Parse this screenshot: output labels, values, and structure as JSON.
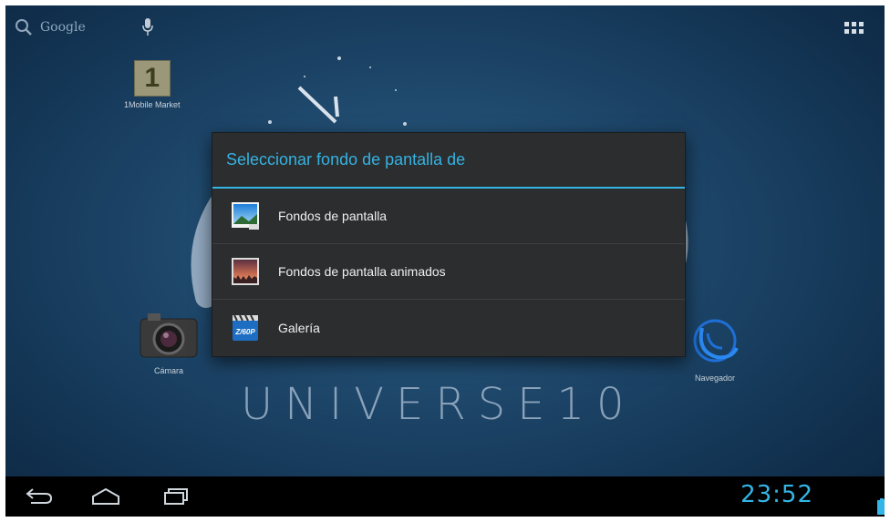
{
  "statusbar": {
    "search_label": "Google",
    "time": "23:52"
  },
  "shortcuts": {
    "market_tile_text": "1",
    "market_label": "1Mobile Market",
    "camera_label": "Cámara",
    "browser_label": "Navegador"
  },
  "wallpaper": {
    "brand_text": "UNIVERSE10"
  },
  "dialog": {
    "title": "Seleccionar fondo de pantalla de",
    "items": [
      {
        "label": "Fondos de pantalla",
        "icon": "wallpapers-icon"
      },
      {
        "label": "Fondos de pantalla animados",
        "icon": "live-wallpapers-icon"
      },
      {
        "label": "Galería",
        "icon": "gallery-icon"
      }
    ]
  },
  "colors": {
    "accent": "#33b5e5",
    "dialog_bg": "#2b2d2f",
    "desktop_bg": "#1c4467"
  }
}
